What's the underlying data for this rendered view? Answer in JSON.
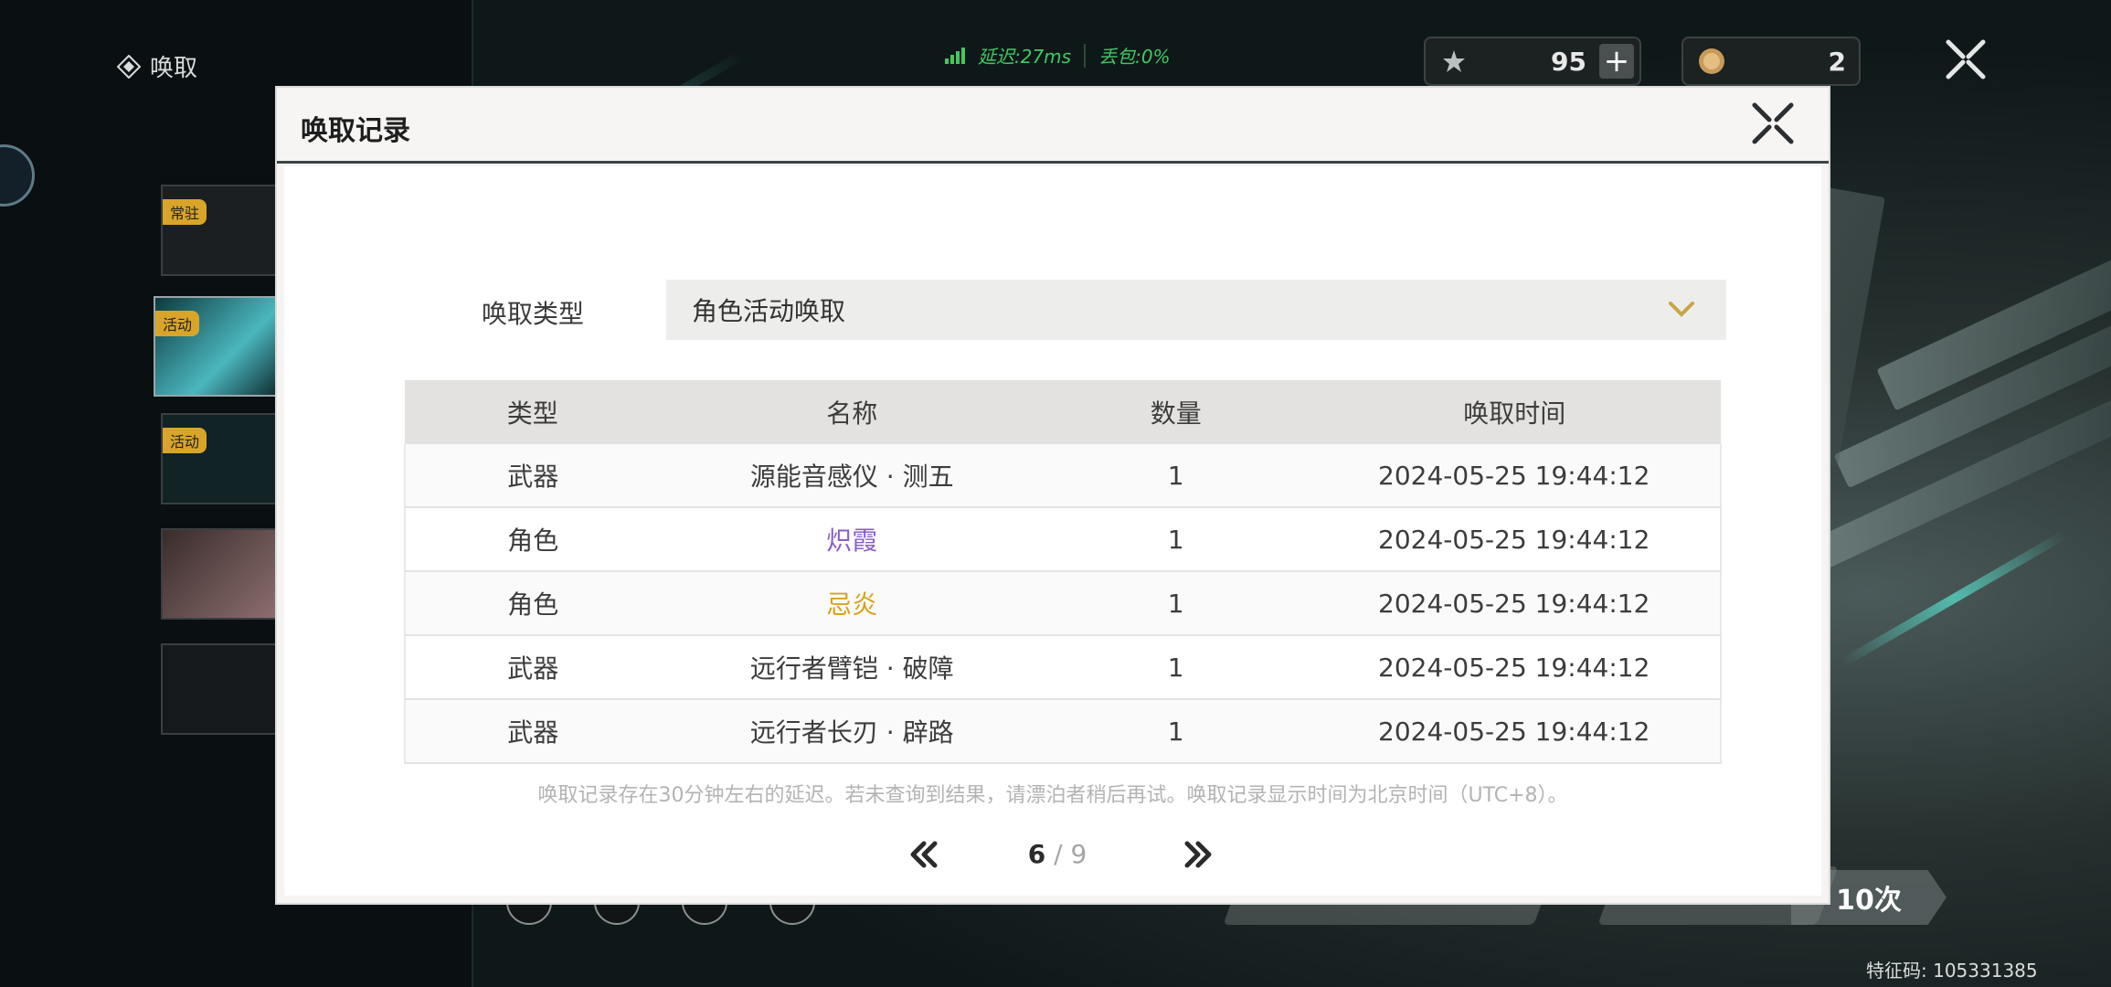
{
  "header": {
    "section_title": "唤取",
    "network": {
      "latency": "延迟:27ms",
      "packet_loss": "丢包:0%"
    },
    "currency": [
      {
        "icon": "star-token-icon",
        "value": "95"
      },
      {
        "icon": "coin-icon",
        "value": "2"
      }
    ]
  },
  "sidebar": {
    "banners": [
      {
        "tag": "常驻"
      },
      {
        "tag": "活动"
      },
      {
        "tag": "活动"
      },
      {
        "tag": ""
      },
      {
        "tag": ""
      }
    ]
  },
  "bottom_bar": {
    "pull_ten_label": "10次",
    "feature_code": "特征码: 105331385"
  },
  "modal": {
    "title": "唤取记录",
    "type_label": "唤取类型",
    "type_selected": "角色活动唤取",
    "table": {
      "headers": [
        "类型",
        "名称",
        "数量",
        "唤取时间"
      ],
      "rows": [
        {
          "type": "武器",
          "name": "源能音感仪 · 测五",
          "qty": "1",
          "time": "2024-05-25 19:44:12",
          "name_color": "#3c3c3c"
        },
        {
          "type": "角色",
          "name": "炽霞",
          "qty": "1",
          "time": "2024-05-25 19:44:12",
          "name_color": "#8a5fc4"
        },
        {
          "type": "角色",
          "name": "忌炎",
          "qty": "1",
          "time": "2024-05-25 19:44:12",
          "name_color": "#d9a21b"
        },
        {
          "type": "武器",
          "name": "远行者臂铠 · 破障",
          "qty": "1",
          "time": "2024-05-25 19:44:12",
          "name_color": "#3c3c3c"
        },
        {
          "type": "武器",
          "name": "远行者长刃 · 辟路",
          "qty": "1",
          "time": "2024-05-25 19:44:12",
          "name_color": "#3c3c3c"
        }
      ]
    },
    "note": "唤取记录存在30分钟左右的延迟。若未查询到结果，请漂泊者稍后再试。唤取记录显示时间为北京时间（UTC+8）。",
    "pagination": {
      "current": "6",
      "separator": "/",
      "total": "9"
    }
  }
}
